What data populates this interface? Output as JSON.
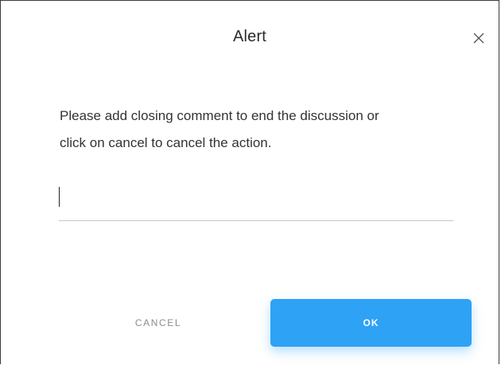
{
  "dialog": {
    "title": "Alert",
    "close_icon": "close-icon",
    "message_line1": "Please add closing comment to end the discussion or",
    "message_line2": "click on cancel to cancel the action.",
    "comment_input": {
      "value": "",
      "placeholder": ""
    },
    "cancel_label": "CANCEL",
    "ok_label": "OK"
  },
  "colors": {
    "accent": "#2ea2f4",
    "text": "#333333",
    "muted": "#8c8c8c"
  }
}
